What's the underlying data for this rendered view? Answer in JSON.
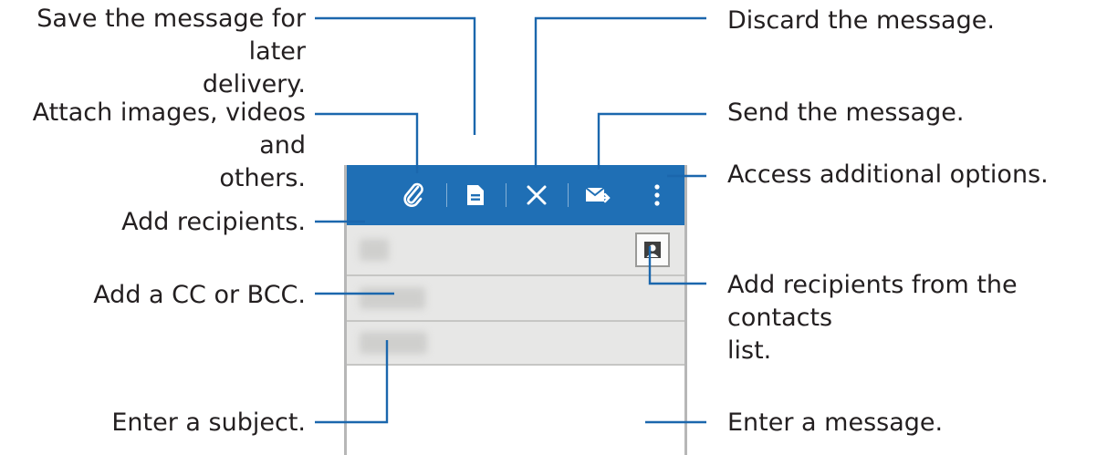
{
  "callouts": {
    "save_later": "Save the message for later\ndelivery.",
    "attach": "Attach images, videos and\nothers.",
    "add_recipients": "Add recipients.",
    "add_cc_bcc": "Add a CC or BCC.",
    "enter_subject": "Enter a subject.",
    "discard": "Discard the message.",
    "send": "Send the message.",
    "more_options": "Access additional options.",
    "add_from_contacts": "Add recipients from the contacts\nlist.",
    "enter_message": "Enter a message."
  },
  "toolbar": {
    "icons": [
      "paperclip-icon",
      "save-draft-icon",
      "close-icon",
      "send-mail-icon",
      "more-vertical-icon"
    ],
    "color": "#1f6fb5"
  },
  "colors": {
    "leader": "#1b67ad",
    "field_bg": "#e7e7e6"
  }
}
